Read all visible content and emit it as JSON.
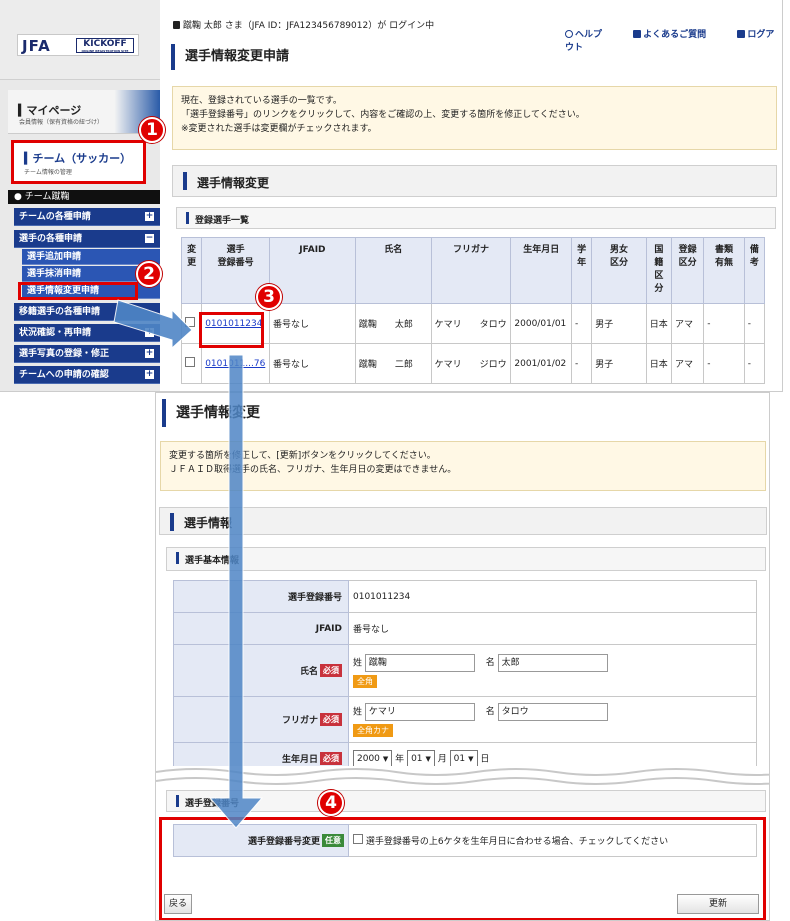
{
  "header": {
    "login_user": "蹴鞠 太郎 さま（JFA ID：JFA123456789012）が ログイン中",
    "help": "ヘルプ",
    "faq": "よくあるご質問",
    "logout": "ログアウト"
  },
  "logo": {
    "jfa": "JFA",
    "kickoff": "KICKOFF",
    "kickoff_sub": "ONLINE REGISTRATION SITE"
  },
  "sidebar": {
    "mypage_title": "マイページ",
    "mypage_sub": "会員情報（保有資格の紐づけ）",
    "team_title": "チーム（サッカー）",
    "team_sub": "チーム情報の管理",
    "team_name": "チーム蹴鞠",
    "items": [
      {
        "label": "チームの各種申請",
        "expand": "+"
      },
      {
        "label": "選手の各種申請",
        "expand": "−"
      },
      {
        "label": "移籍選手の各種申請",
        "expand": ""
      },
      {
        "label": "状況確認・再申請",
        "expand": "+"
      },
      {
        "label": "選手写真の登録・修正",
        "expand": "+"
      },
      {
        "label": "チームへの申請の確認",
        "expand": "+"
      }
    ],
    "subitems": [
      "選手追加申請",
      "選手抹消申請",
      "選手情報変更申請"
    ]
  },
  "list_page": {
    "title": "選手情報変更申請",
    "note": [
      "現在、登録されている選手の一覧です。",
      "「選手登録番号」のリンクをクリックして、内容をご確認の上、変更する箇所を修正してください。",
      "※変更された選手は変更欄がチェックされます。"
    ],
    "section": "選手情報変更",
    "subsection": "登録選手一覧",
    "columns": [
      "変\n更",
      "選手\n登録番号",
      "JFAID",
      "氏名",
      "フリガナ",
      "生年月日",
      "学\n年",
      "男女\n区分",
      "国\n籍\n区\n分",
      "登録\n区分",
      "書類\n有無",
      "備\n考"
    ],
    "rows": [
      {
        "reg_no": "0101011234",
        "jfaid": "番号なし",
        "name": "蹴鞠　　太郎",
        "kana": "ケマリ　　タロウ",
        "birth": "2000/01/01",
        "grade": "-",
        "gender": "男子",
        "nation": "日本",
        "reg_type": "アマ",
        "docs": "-",
        "remarks": "-"
      },
      {
        "reg_no": "0101011...76",
        "jfaid": "番号なし",
        "name": "蹴鞠　　二郎",
        "kana": "ケマリ　　ジロウ",
        "birth": "2001/01/02",
        "grade": "-",
        "gender": "男子",
        "nation": "日本",
        "reg_type": "アマ",
        "docs": "-",
        "remarks": "-"
      }
    ]
  },
  "edit_page": {
    "title": "選手情報変更",
    "note": [
      "変更する箇所を修正して、[更新]ボタンをクリックしてください。",
      "ＪＦＡＩＤ取得選手の氏名、フリガナ、生年月日の変更はできません。"
    ],
    "section": "選手情報",
    "subsection": "選手基本情報",
    "fields": {
      "reg_no_label": "選手登録番号",
      "reg_no_value": "0101011234",
      "jfaid_label": "JFAID",
      "jfaid_value": "番号なし",
      "name_label": "氏名",
      "kana_label": "フリガナ",
      "birth_label": "生年月日",
      "required": "必須",
      "optional": "任意",
      "sei": "姓",
      "mei": "名",
      "last_name": "蹴鞠",
      "first_name": "太郎",
      "last_kana": "ケマリ",
      "first_kana": "タロウ",
      "zenkaku_hint": "全角",
      "zenkaku_kana_hint": "全角カナ",
      "birth_year": "2000",
      "birth_month": "01",
      "birth_day": "01",
      "year_unit": "年",
      "month_unit": "月",
      "day_unit": "日"
    },
    "reg_subsection": "選手登録番号",
    "reg_change_label": "選手登録番号変更",
    "reg_change_text": "選手登録番号の上6ケタを生年月日に合わせる場合、チェックしてください",
    "back_button": "戻る",
    "update_button": "更新"
  },
  "callouts": [
    "1",
    "2",
    "3",
    "4"
  ],
  "colors": {
    "accent_red": "#e00000",
    "nav_blue": "#1a3b8c",
    "sub_blue": "#2b56b4",
    "arrow_blue": "#4f86c6"
  }
}
